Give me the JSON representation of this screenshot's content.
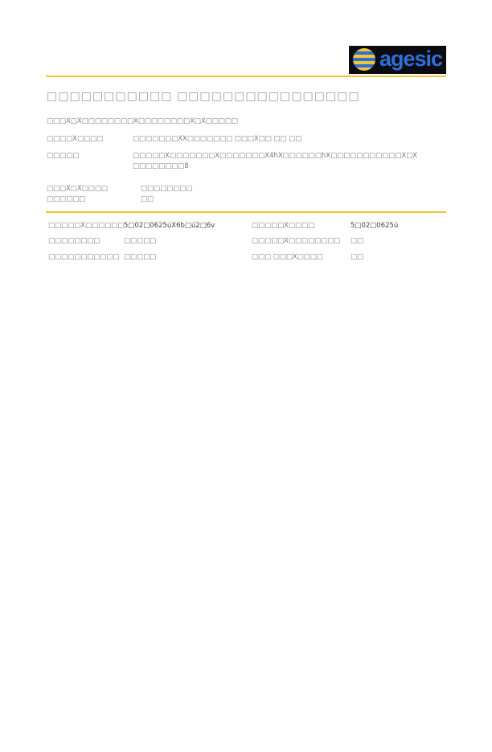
{
  "header": {
    "logo_text": "agesic",
    "colors": {
      "rule": "#f0c632",
      "logo_bg": "#0b0b12",
      "logo_text": "#2e6fd8"
    }
  },
  "document": {
    "title": "□□□□□□□□□□□ □□□□□□□□□□□□□□□□",
    "subtitle": "□□□X□X□□□□□□□□X□□□□□□□□X□X□□□□□",
    "fields": [
      {
        "label": "□□□□X□□□□",
        "value": "□□□□□□□XX□□□□□□□ □□□X□□ □□ □□"
      },
      {
        "label": "□□□□□",
        "value": "□□□□□X□□□□□□□X□□□□□□□X4hX□□□□□□hX□□□□□□□□□□□X□X",
        "value2": "□□□□□□□□8"
      },
      {
        "label": "□□□X□X□□□□",
        "label2": "□□□□□□",
        "value": "□□□□□□□□",
        "value2": "□□"
      }
    ],
    "table": [
      {
        "l1": "□□□□□X□□□□□□",
        "v1": "5□02□0625úX6b□ú2□6v",
        "l2": "□□□□□X□□□□",
        "v2": "5□02□0625ú"
      },
      {
        "l1": "□□□□□□□□",
        "v1": "□□□□□",
        "l2": "□□□□□X□□□□□□□□",
        "v2": "□□"
      },
      {
        "l1": "□□□□□□□□□□□",
        "v1": "□□□□□",
        "l2": "□□□ □□□X□□□□",
        "v2": "□□"
      }
    ]
  }
}
